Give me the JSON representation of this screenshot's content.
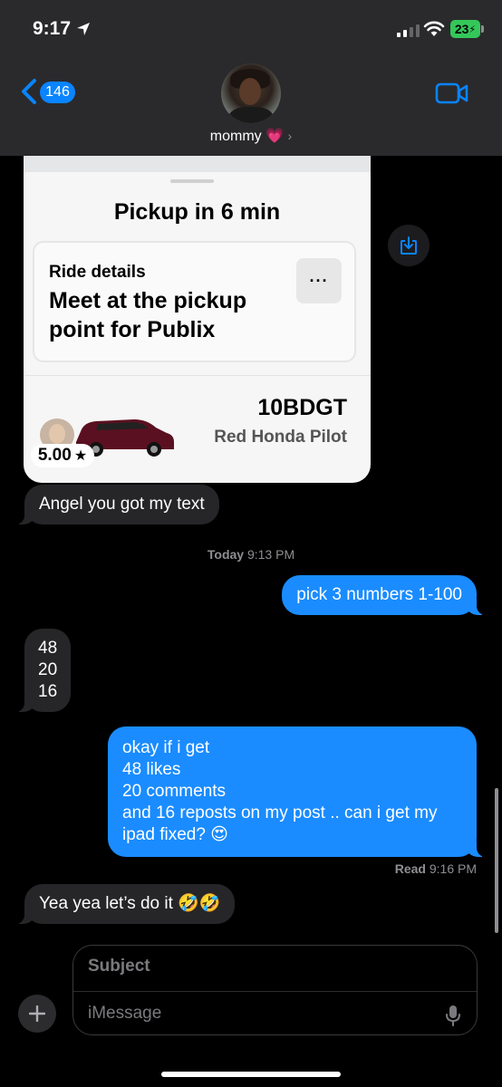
{
  "status_bar": {
    "time": "9:17",
    "battery": "23"
  },
  "nav": {
    "back_count": "146",
    "contact_name": "mommy"
  },
  "ride_card": {
    "title": "Pickup in 6 min",
    "details_label": "Ride details",
    "details_text": "Meet at the pickup point for Publix",
    "more": "···",
    "plate": "10BDGT",
    "car": "Red Honda Pilot",
    "rating": "5.00"
  },
  "messages": [
    {
      "direction": "in",
      "text": "Angel you got my text"
    },
    {
      "direction": "out",
      "text": "pick 3 numbers 1-100"
    },
    {
      "direction": "in",
      "text": "48\n20\n16"
    },
    {
      "direction": "out",
      "text": "okay if i get\n48 likes\n20 comments\nand 16 reposts on my post .. can i get my ipad fixed? 😍"
    },
    {
      "direction": "in",
      "text": "Yea yea let’s do it 🤣🤣"
    }
  ],
  "timestamp": {
    "day": "Today",
    "time": "9:13 PM"
  },
  "read_receipt": {
    "label": "Read",
    "time": "9:16 PM"
  },
  "compose": {
    "subject_placeholder": "Subject",
    "message_placeholder": "iMessage"
  },
  "colors": {
    "outgoing_bubble": "#1a8cff",
    "incoming_bubble": "#262628",
    "accent": "#0a84ff",
    "battery": "#34c759"
  }
}
